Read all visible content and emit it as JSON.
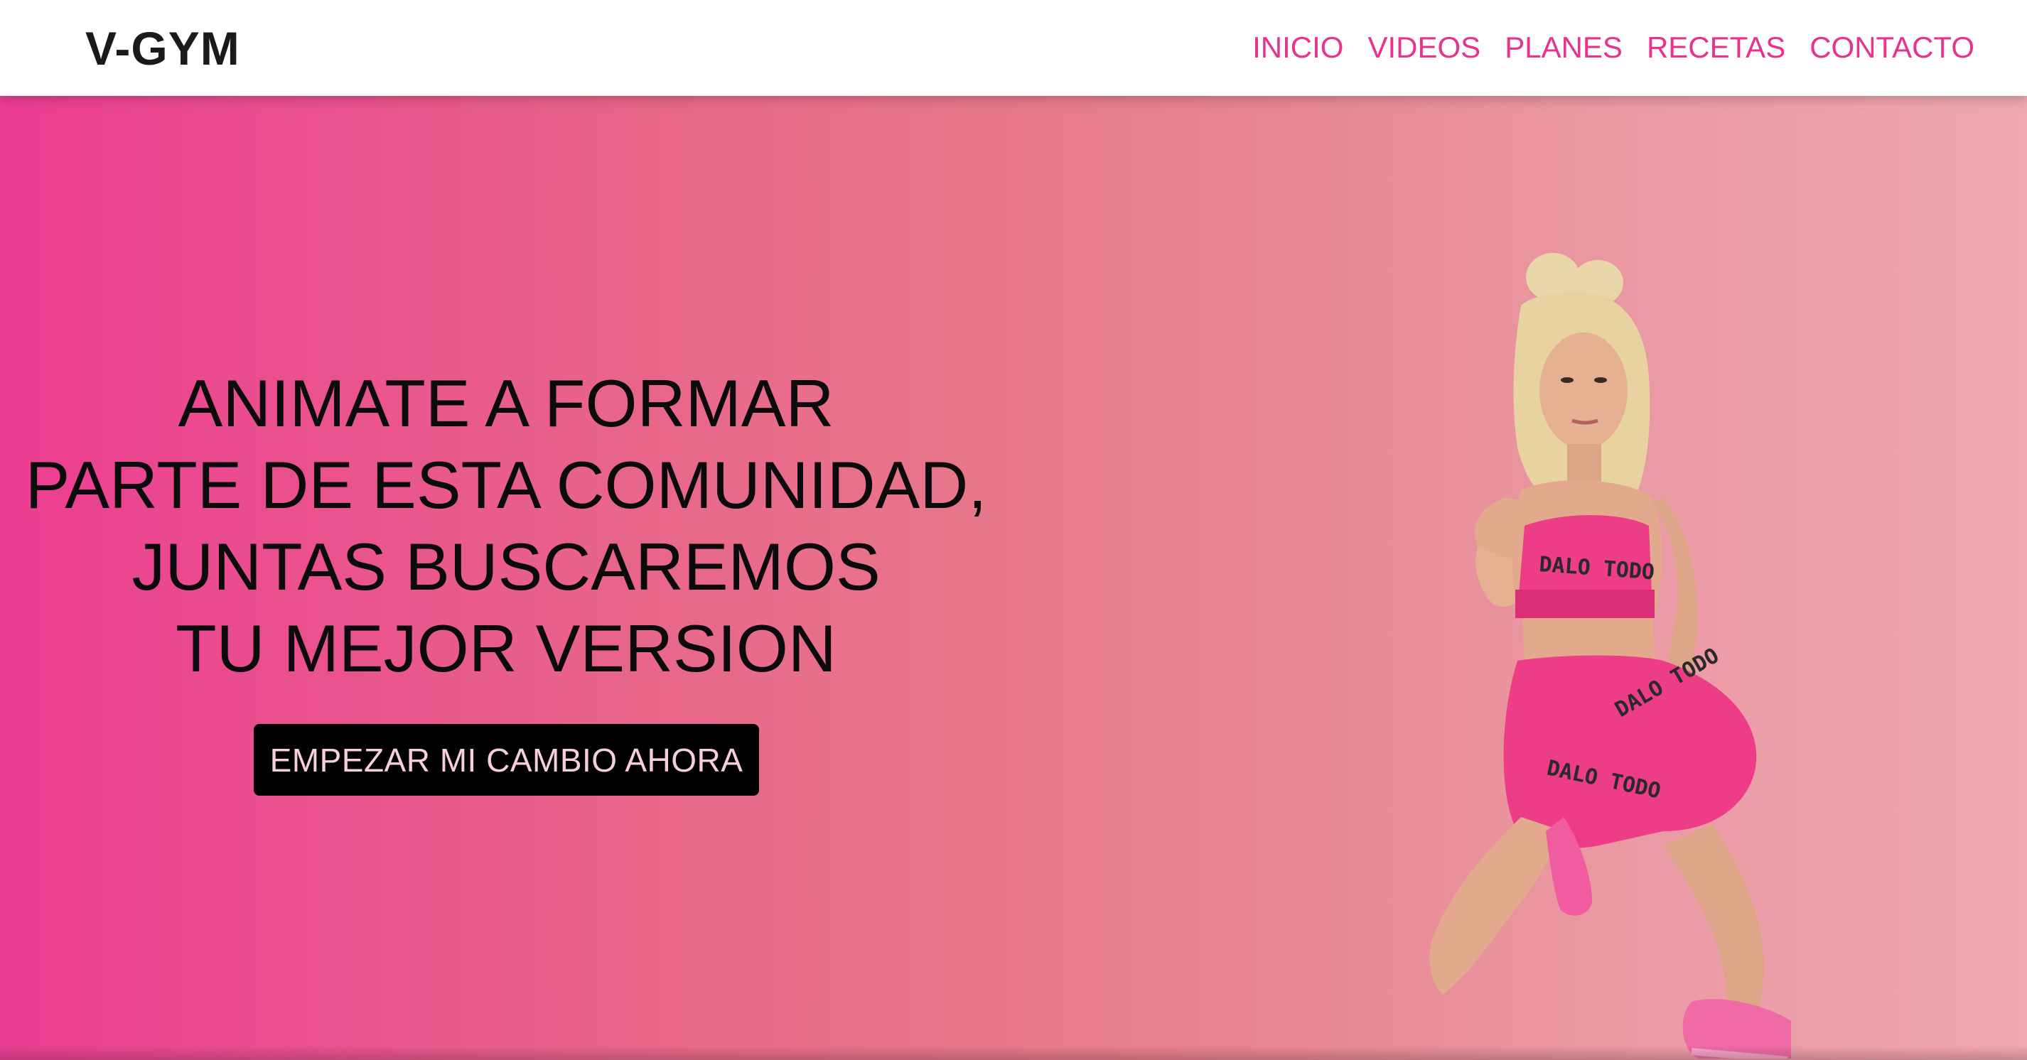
{
  "header": {
    "logo": "V-GYM",
    "nav": [
      {
        "label": "INICIO"
      },
      {
        "label": "VIDEOS"
      },
      {
        "label": "PLANES"
      },
      {
        "label": "RECETAS"
      },
      {
        "label": "CONTACTO"
      }
    ]
  },
  "hero": {
    "headline_lines": [
      "ANIMATE A FORMAR",
      "PARTE DE ESTA COMUNIDAD,",
      "JUNTAS BUSCAREMOS",
      "TU MEJOR VERSION"
    ],
    "cta_label": "EMPEZAR MI CAMBIO AHORA",
    "image": {
      "top_print": "DALO TODO",
      "shorts_print": "DALO TODO"
    }
  },
  "colors": {
    "accent": "#e8338d",
    "gradient_start": "#ec3d92",
    "gradient_end": "#f0a8b1",
    "button_bg": "#000000",
    "button_text": "#f6cfda"
  }
}
